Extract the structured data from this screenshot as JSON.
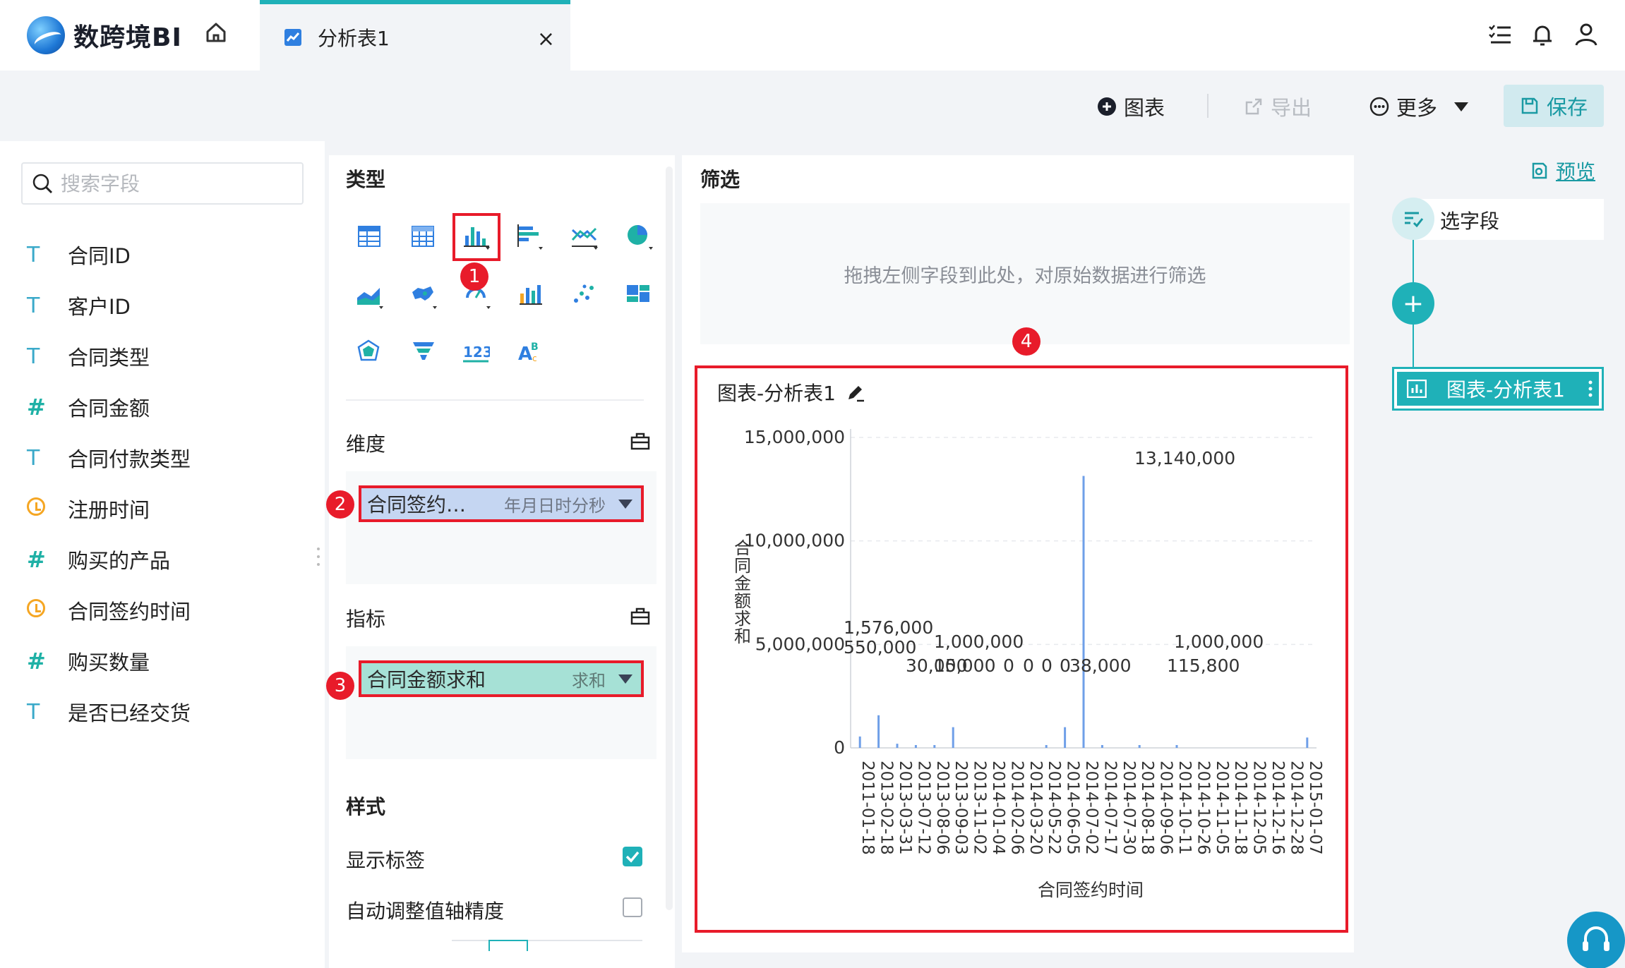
{
  "app": {
    "name": "数跨境BI"
  },
  "tab": {
    "label": "分析表1",
    "close": "×"
  },
  "toolbar": {
    "chart": "图表",
    "export": "导出",
    "more": "更多",
    "save": "保存"
  },
  "fields": {
    "search_placeholder": "搜索字段",
    "items": [
      {
        "icon": "T",
        "label": "合同ID"
      },
      {
        "icon": "T",
        "label": "客户ID"
      },
      {
        "icon": "T",
        "label": "合同类型"
      },
      {
        "icon": "#",
        "label": "合同金额"
      },
      {
        "icon": "T",
        "label": "合同付款类型"
      },
      {
        "icon": "clock",
        "label": "注册时间"
      },
      {
        "icon": "#",
        "label": "购买的产品"
      },
      {
        "icon": "clock",
        "label": "合同签约时间"
      },
      {
        "icon": "#",
        "label": "购买数量"
      },
      {
        "icon": "T",
        "label": "是否已经交货"
      }
    ]
  },
  "config": {
    "type_title": "类型",
    "dimension_title": "维度",
    "dimension_pill": {
      "label": "合同签约…",
      "sub": "年月日时分秒"
    },
    "metric_title": "指标",
    "metric_pill": {
      "label": "合同金额求和",
      "sub": "求和"
    },
    "style_title": "样式",
    "show_labels": {
      "label": "显示标签",
      "checked": true
    },
    "auto_precision": {
      "label": "自动调整值轴精度",
      "checked": false
    },
    "badges": [
      "1",
      "2",
      "3",
      "4"
    ]
  },
  "filter": {
    "title": "筛选",
    "hint": "拖拽左侧字段到此处，对原始数据进行筛选"
  },
  "chart_title": "图表-分析表1",
  "right": {
    "preview": "预览",
    "select_fields": "选字段",
    "add": "+",
    "node": "图表-分析表1"
  },
  "colors": {
    "accent": "#1fb1b8",
    "highlight": "#e81b2a",
    "bar": "#6f9fe8"
  },
  "chart_data": {
    "type": "bar",
    "xlabel": "合同签约时间",
    "ylabel": "合同金额求和",
    "ylim": [
      0,
      15000000
    ],
    "yticks": [
      0,
      5000000,
      10000000,
      15000000
    ],
    "ytick_labels": [
      "0",
      "5,000,000",
      "10,000,000",
      "15,000,000"
    ],
    "categories": [
      "2011-01-18",
      "2013-02-18",
      "2013-03-31",
      "2013-07-12",
      "2013-08-06",
      "2013-09-03",
      "2013-11-02",
      "2014-01-04",
      "2014-02-06",
      "2014-03-20",
      "2014-05-22",
      "2014-06-05",
      "2014-07-02",
      "2014-07-17",
      "2014-07-30",
      "2014-08-18",
      "2014-09-06",
      "2014-10-11",
      "2014-10-26",
      "2014-11-05",
      "2014-11-18",
      "2014-12-05",
      "2014-12-16",
      "2014-12-28",
      "2015-01-07"
    ],
    "values": [
      550000,
      1576000,
      200000,
      30000,
      15000,
      1000000,
      0,
      0,
      0,
      0,
      38000,
      1000000,
      13140000,
      115800,
      0,
      80000,
      0,
      30000,
      0,
      0,
      0,
      0,
      0,
      0,
      500000
    ],
    "data_labels": [
      {
        "text": "1,576,000",
        "value": 1576000
      },
      {
        "text": "550,000",
        "value": 550000
      },
      {
        "text": "30,000",
        "value": 30000
      },
      {
        "text": "1,000,000",
        "value": 1000000
      },
      {
        "text": "15,000",
        "value": 15000
      },
      {
        "text": "0",
        "value": 0
      },
      {
        "text": "0",
        "value": 0
      },
      {
        "text": "0",
        "value": 0
      },
      {
        "text": "0",
        "value": 0
      },
      {
        "text": "38,000",
        "value": 38000
      },
      {
        "text": "1,000,000",
        "value": 1000000
      },
      {
        "text": "115,800",
        "value": 115800
      },
      {
        "text": "13,140,000",
        "value": 13140000
      }
    ]
  }
}
